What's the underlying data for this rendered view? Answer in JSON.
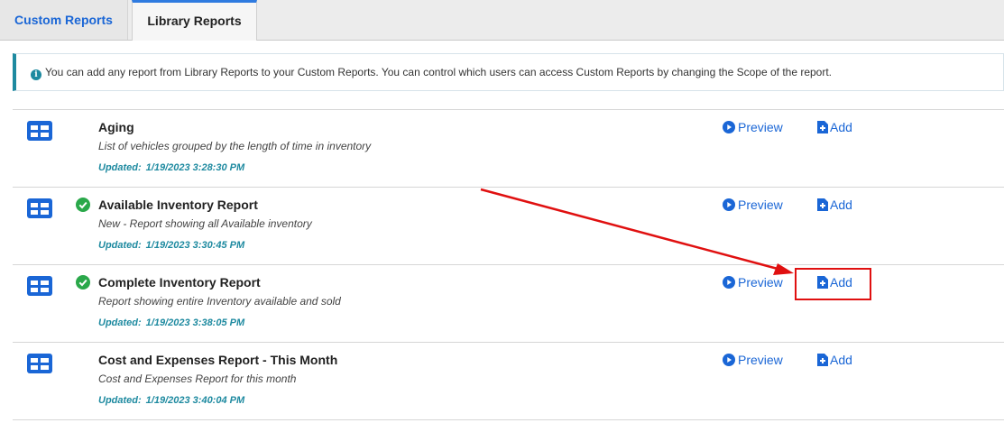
{
  "tabs": [
    {
      "label": "Custom Reports",
      "active": false
    },
    {
      "label": "Library Reports",
      "active": true
    }
  ],
  "info": {
    "text": "You can add any report from Library Reports to your Custom Reports. You can control which users can access Custom Reports by changing the Scope of the report.",
    "icon": "info-icon"
  },
  "reports": [
    {
      "title": "Aging",
      "description": "List of vehicles grouped by the length of time in inventory",
      "updated_label": "Updated:",
      "updated_value": "1/19/2023 3:28:30 PM",
      "added": false
    },
    {
      "title": "Available Inventory Report",
      "description": "New - Report showing all Available inventory",
      "updated_label": "Updated:",
      "updated_value": "1/19/2023 3:30:45 PM",
      "added": true
    },
    {
      "title": "Complete Inventory Report",
      "description": "Report showing entire Inventory available and sold",
      "updated_label": "Updated:",
      "updated_value": "1/19/2023 3:38:05 PM",
      "added": true
    },
    {
      "title": "Cost and Expenses Report - This Month",
      "description": "Cost and Expenses Report for this month",
      "updated_label": "Updated:",
      "updated_value": "1/19/2023 3:40:04 PM",
      "added": false
    }
  ],
  "actions": {
    "preview_label": "Preview",
    "add_label": "Add"
  },
  "colors": {
    "accent": "#1a66d6",
    "teal": "#1e8aa0",
    "success": "#2aa84a",
    "annotation": "#e01010"
  }
}
